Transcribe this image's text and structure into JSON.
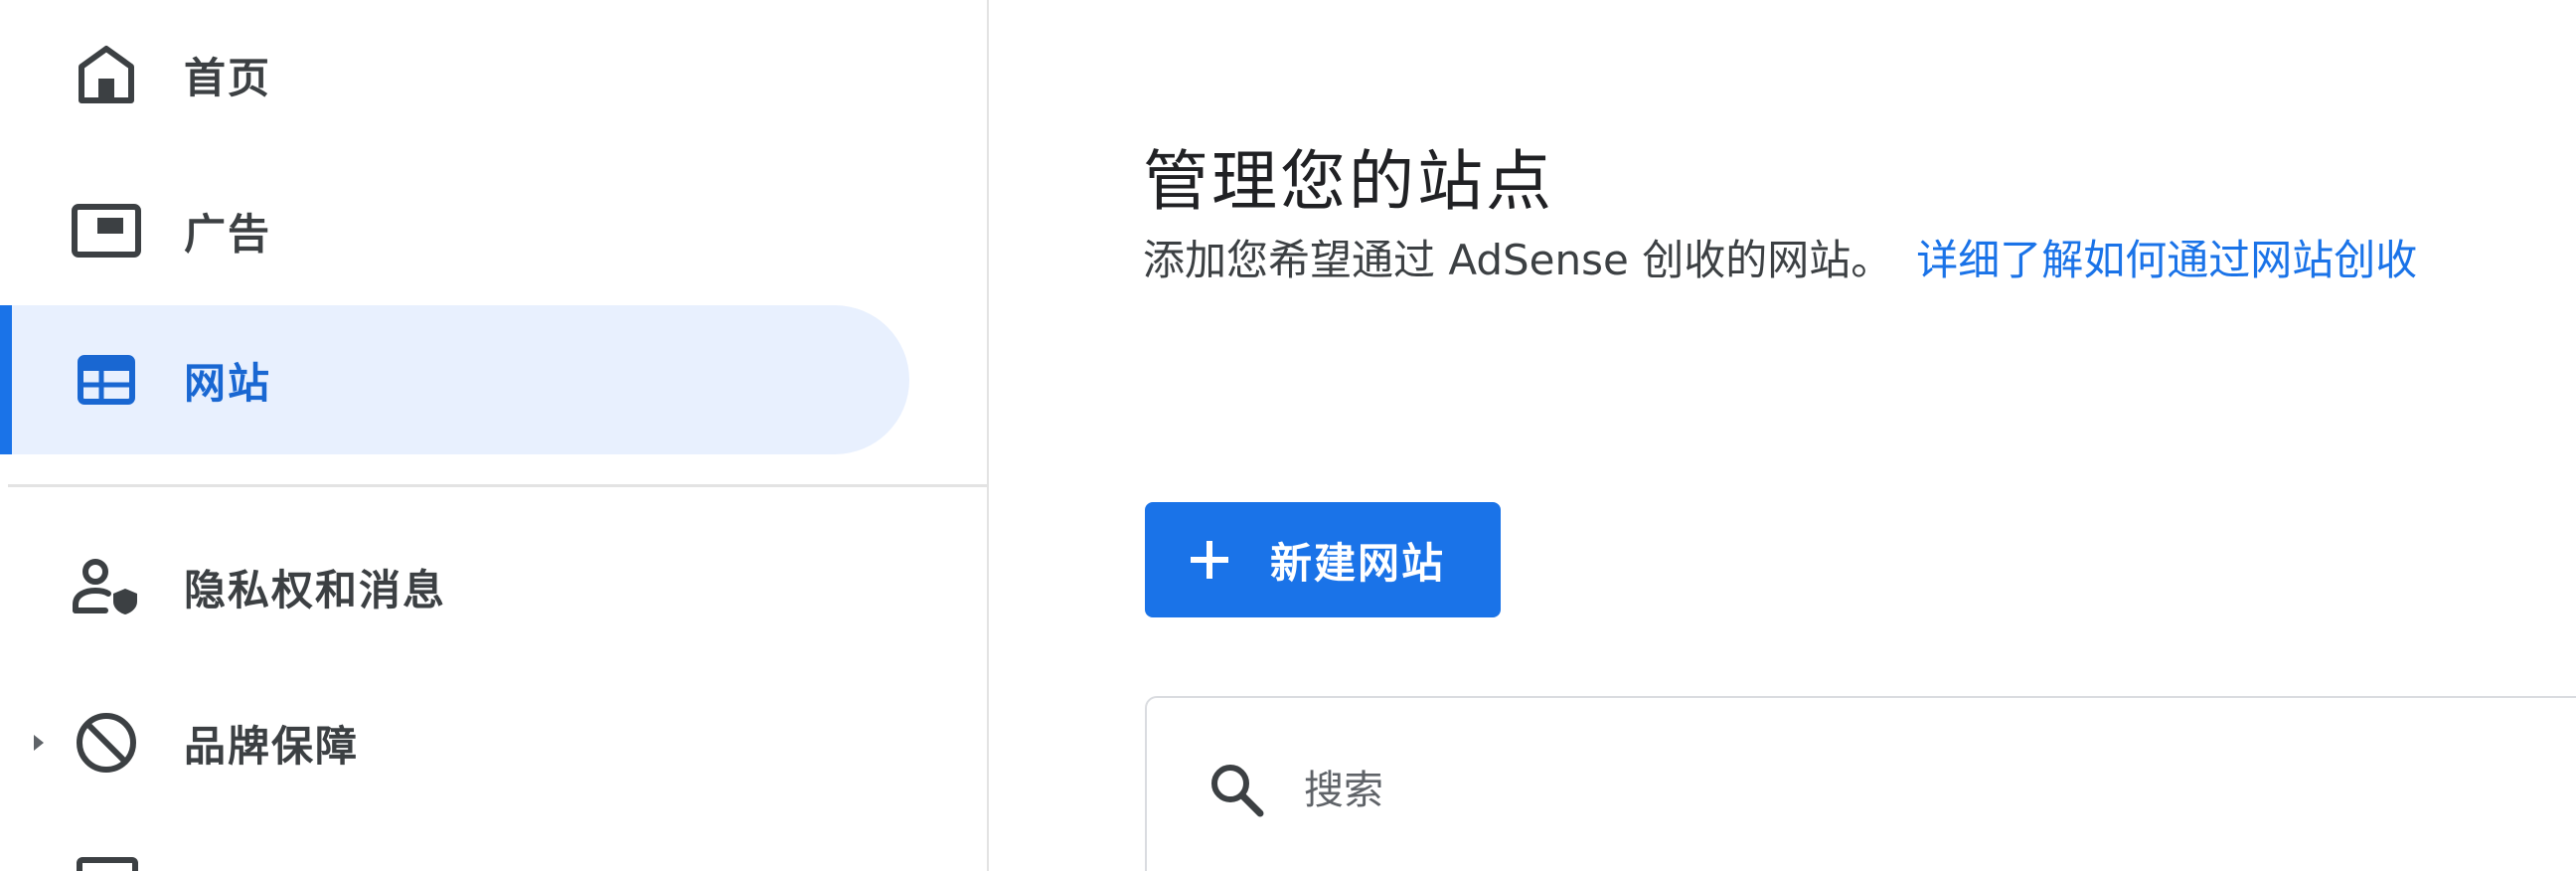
{
  "sidebar": {
    "items": [
      {
        "label": "首页",
        "icon": "home-icon",
        "active": false
      },
      {
        "label": "广告",
        "icon": "ads-icon",
        "active": false
      },
      {
        "label": "网站",
        "icon": "sites-icon",
        "active": true
      },
      {
        "label": "隐私权和消息",
        "icon": "privacy-messaging-icon",
        "active": false
      },
      {
        "label": "品牌保障",
        "icon": "block-icon",
        "active": false,
        "expandable": true
      }
    ]
  },
  "main": {
    "title": "管理您的站点",
    "description": "添加您希望通过 AdSense 创收的网站。",
    "learn_more_link": "详细了解如何通过网站创收",
    "new_site_button": "新建网站",
    "search": {
      "placeholder": "搜索",
      "value": ""
    }
  },
  "colors": {
    "accent": "#1a73e8",
    "active_bg": "#e8f0fe",
    "text_primary": "#202124",
    "text_secondary": "#3c4043",
    "divider": "#e3e3e3"
  }
}
